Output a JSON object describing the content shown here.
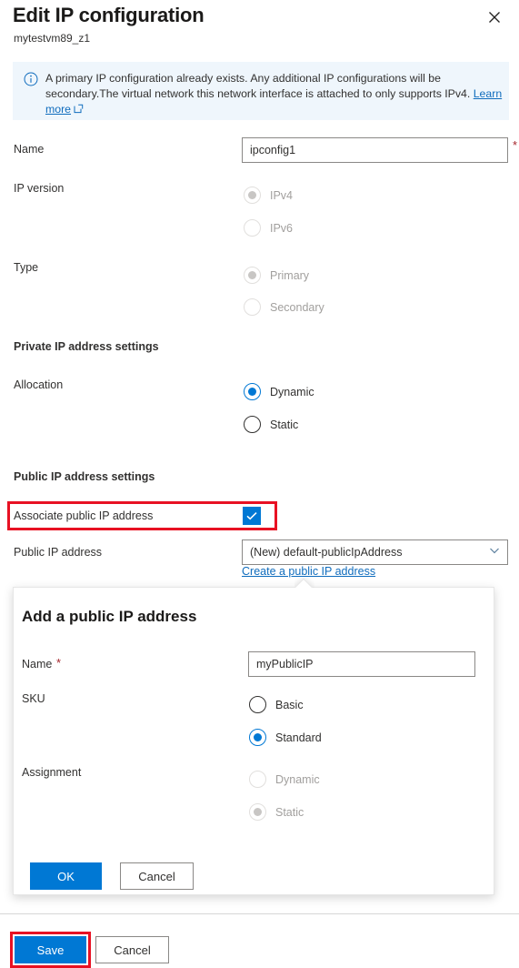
{
  "blade": {
    "title": "Edit IP configuration",
    "subtitle": "mytestvm89_z1",
    "close_icon": "close-icon"
  },
  "banner": {
    "icon": "info-icon",
    "text": "A primary IP configuration already exists. Any additional IP configurations will be secondary.The virtual network this network interface is attached to only supports IPv4.",
    "link_text_1": "Learn",
    "link_text_2": "more",
    "external_icon": "external-link-icon",
    "background": "#eff6fc"
  },
  "form": {
    "name": {
      "label": "Name",
      "value": "ipconfig1",
      "placeholder": "",
      "required_marker": "*"
    },
    "ip_version": {
      "label": "IP version",
      "options": [
        {
          "label": "IPv4",
          "selected": true,
          "disabled": true
        },
        {
          "label": "IPv6",
          "selected": false,
          "disabled": true
        }
      ]
    },
    "type": {
      "label": "Type",
      "options": [
        {
          "label": "Primary",
          "selected": true,
          "disabled": true
        },
        {
          "label": "Secondary",
          "selected": false,
          "disabled": true
        }
      ]
    },
    "private_section": {
      "heading": "Private IP address settings",
      "allocation": {
        "label": "Allocation",
        "options": [
          {
            "label": "Dynamic",
            "selected": true,
            "disabled": false
          },
          {
            "label": "Static",
            "selected": false,
            "disabled": false
          }
        ]
      }
    },
    "public_section": {
      "heading": "Public IP address settings",
      "associate": {
        "label": "Associate public IP address",
        "checked": true
      },
      "public_ip": {
        "label": "Public IP address",
        "selected_option": "(New) default-publicIpAddress",
        "chevron_icon": "chevron-down-icon",
        "create_link": "Create a public IP address"
      }
    }
  },
  "flyout": {
    "title": "Add a public IP address",
    "name": {
      "label": "Name",
      "required_marker": "*",
      "value": "myPublicIP",
      "placeholder": ""
    },
    "sku": {
      "label": "SKU",
      "options": [
        {
          "label": "Basic",
          "selected": false,
          "disabled": false
        },
        {
          "label": "Standard",
          "selected": true,
          "disabled": false
        }
      ]
    },
    "assignment": {
      "label": "Assignment",
      "options": [
        {
          "label": "Dynamic",
          "selected": false,
          "disabled": true
        },
        {
          "label": "Static",
          "selected": true,
          "disabled": true
        }
      ]
    },
    "ok_label": "OK",
    "cancel_label": "Cancel"
  },
  "footer": {
    "save_label": "Save",
    "cancel_label": "Cancel"
  },
  "colors": {
    "accent": "#0078d4",
    "link": "#0f6cbd",
    "annotation": "#e81123",
    "required": "#a4262c"
  }
}
